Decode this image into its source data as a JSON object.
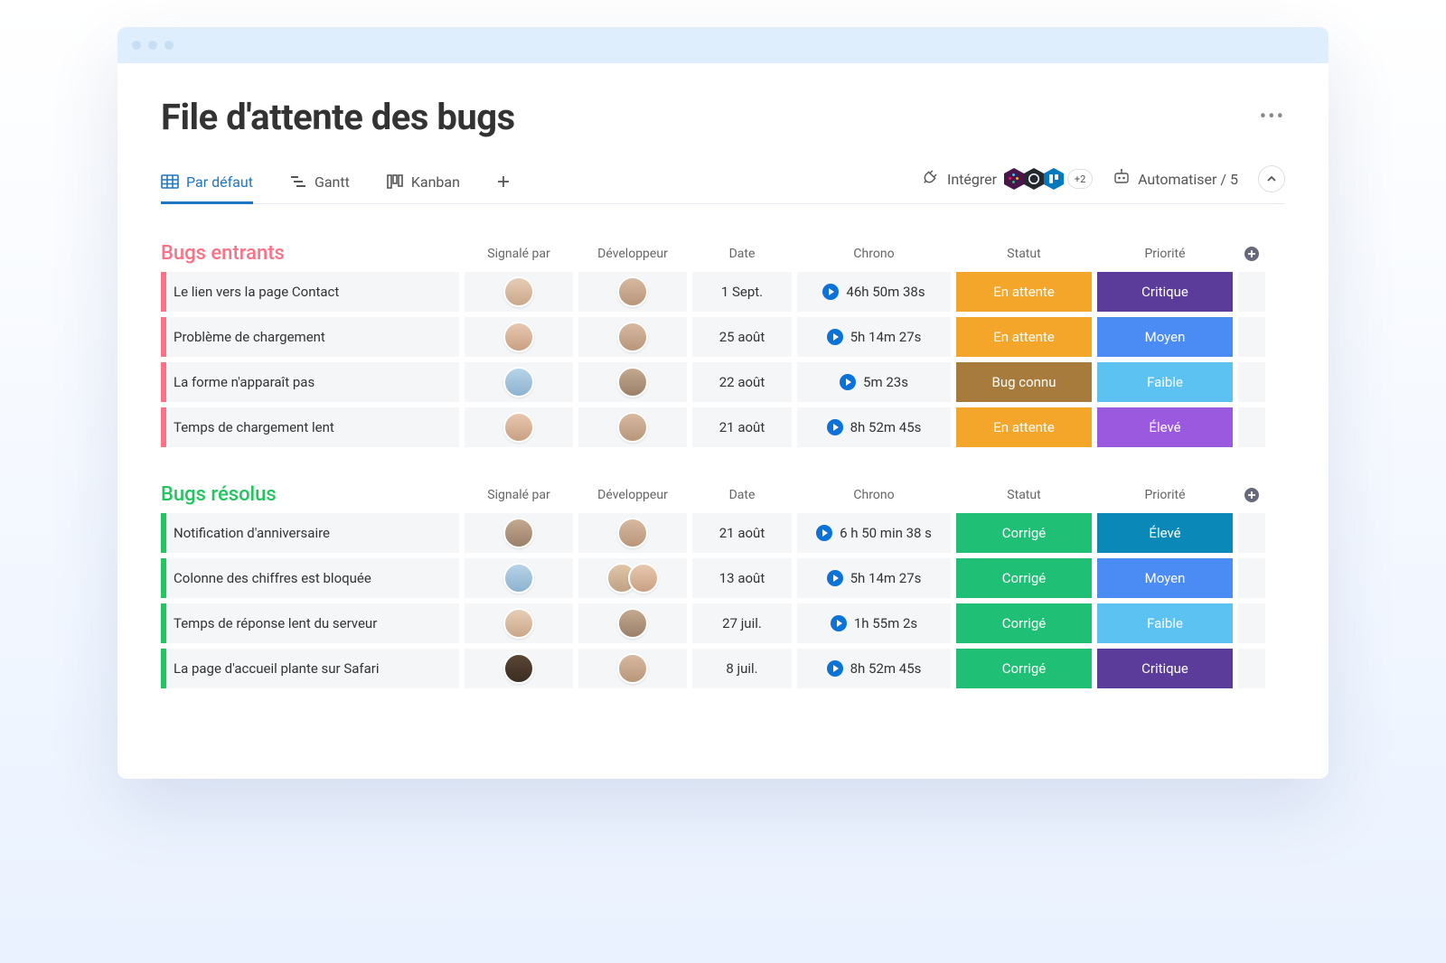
{
  "page": {
    "title": "File d'attente des bugs"
  },
  "toolbar": {
    "views": {
      "default": "Par défaut",
      "gantt": "Gantt",
      "kanban": "Kanban"
    },
    "integrate_label": "Intégrer",
    "integrate_more": "+2",
    "automate_label": "Automatiser / 5"
  },
  "columns": {
    "reporter": "Signalé par",
    "developer": "Développeur",
    "date": "Date",
    "chrono": "Chrono",
    "status": "Statut",
    "priority": "Priorité"
  },
  "groups": {
    "incoming": {
      "title": "Bugs entrants",
      "color": "#fb7185",
      "rows": [
        {
          "task": "Le lien vers la page Contact",
          "date": "1 Sept.",
          "chrono": "46h 50m 38s",
          "status": {
            "label": "En attente",
            "color": "#f4a62a"
          },
          "priority": {
            "label": "Critique",
            "color": "#5b3c9b"
          }
        },
        {
          "task": "Problème de chargement",
          "date": "25 août",
          "chrono": "5h 14m 27s",
          "status": {
            "label": "En attente",
            "color": "#f4a62a"
          },
          "priority": {
            "label": "Moyen",
            "color": "#4b8bf4"
          }
        },
        {
          "task": "La forme n'apparaît pas",
          "date": "22 août",
          "chrono": "5m 23s",
          "status": {
            "label": "Bug connu",
            "color": "#a77b3b"
          },
          "priority": {
            "label": "Faible",
            "color": "#5cc2f2"
          }
        },
        {
          "task": "Temps de chargement lent",
          "date": "21 août",
          "chrono": "8h 52m 45s",
          "status": {
            "label": "En attente",
            "color": "#f4a62a"
          },
          "priority": {
            "label": "Élevé",
            "color": "#9b59e0"
          }
        }
      ]
    },
    "resolved": {
      "title": "Bugs résolus",
      "color": "#22c55e",
      "rows": [
        {
          "task": "Notification d'anniversaire",
          "date": "21 août",
          "chrono": "6 h 50 min 38 s",
          "status": {
            "label": "Corrigé",
            "color": "#1fbf75"
          },
          "priority": {
            "label": "Élevé",
            "color": "#0a89b8"
          }
        },
        {
          "task": "Colonne des chiffres est bloquée",
          "date": "13 août",
          "chrono": "5h 14m 27s",
          "status": {
            "label": "Corrigé",
            "color": "#1fbf75"
          },
          "priority": {
            "label": "Moyen",
            "color": "#4b8bf4"
          }
        },
        {
          "task": "Temps de réponse lent du serveur",
          "date": "27 juil.",
          "chrono": "1h 55m 2s",
          "status": {
            "label": "Corrigé",
            "color": "#1fbf75"
          },
          "priority": {
            "label": "Faible",
            "color": "#5cc2f2"
          }
        },
        {
          "task": "La page d'accueil plante sur Safari",
          "date": "8 juil.",
          "chrono": "8h 52m 45s",
          "status": {
            "label": "Corrigé",
            "color": "#1fbf75"
          },
          "priority": {
            "label": "Critique",
            "color": "#5b3c9b"
          }
        }
      ]
    }
  }
}
